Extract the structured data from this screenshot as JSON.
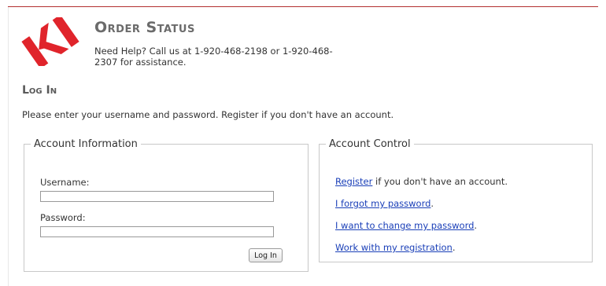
{
  "header": {
    "title": "Order Status",
    "help": "Need Help? Call us at 1-920-468-2198 or 1-920-468-2307 for assistance.",
    "logo_text": "KI"
  },
  "login": {
    "title": "Log In",
    "instructions": "Please enter your username and password. Register if you don't have an account."
  },
  "account_info": {
    "legend": "Account Information",
    "username_label": "Username:",
    "username_value": "",
    "password_label": "Password:",
    "password_value": "",
    "login_button": "Log In"
  },
  "account_control": {
    "legend": "Account Control",
    "register_link": "Register",
    "register_suffix": " if you don't have an account.",
    "forgot_link": "I forgot my password",
    "forgot_suffix": ".",
    "change_link": "I want to change my password",
    "change_suffix": ".",
    "registration_link": "Work with my registration",
    "registration_suffix": "."
  },
  "colors": {
    "brand_red": "#e0242b",
    "rule_red": "#b22f2f",
    "link_blue": "#1a3fb8"
  }
}
